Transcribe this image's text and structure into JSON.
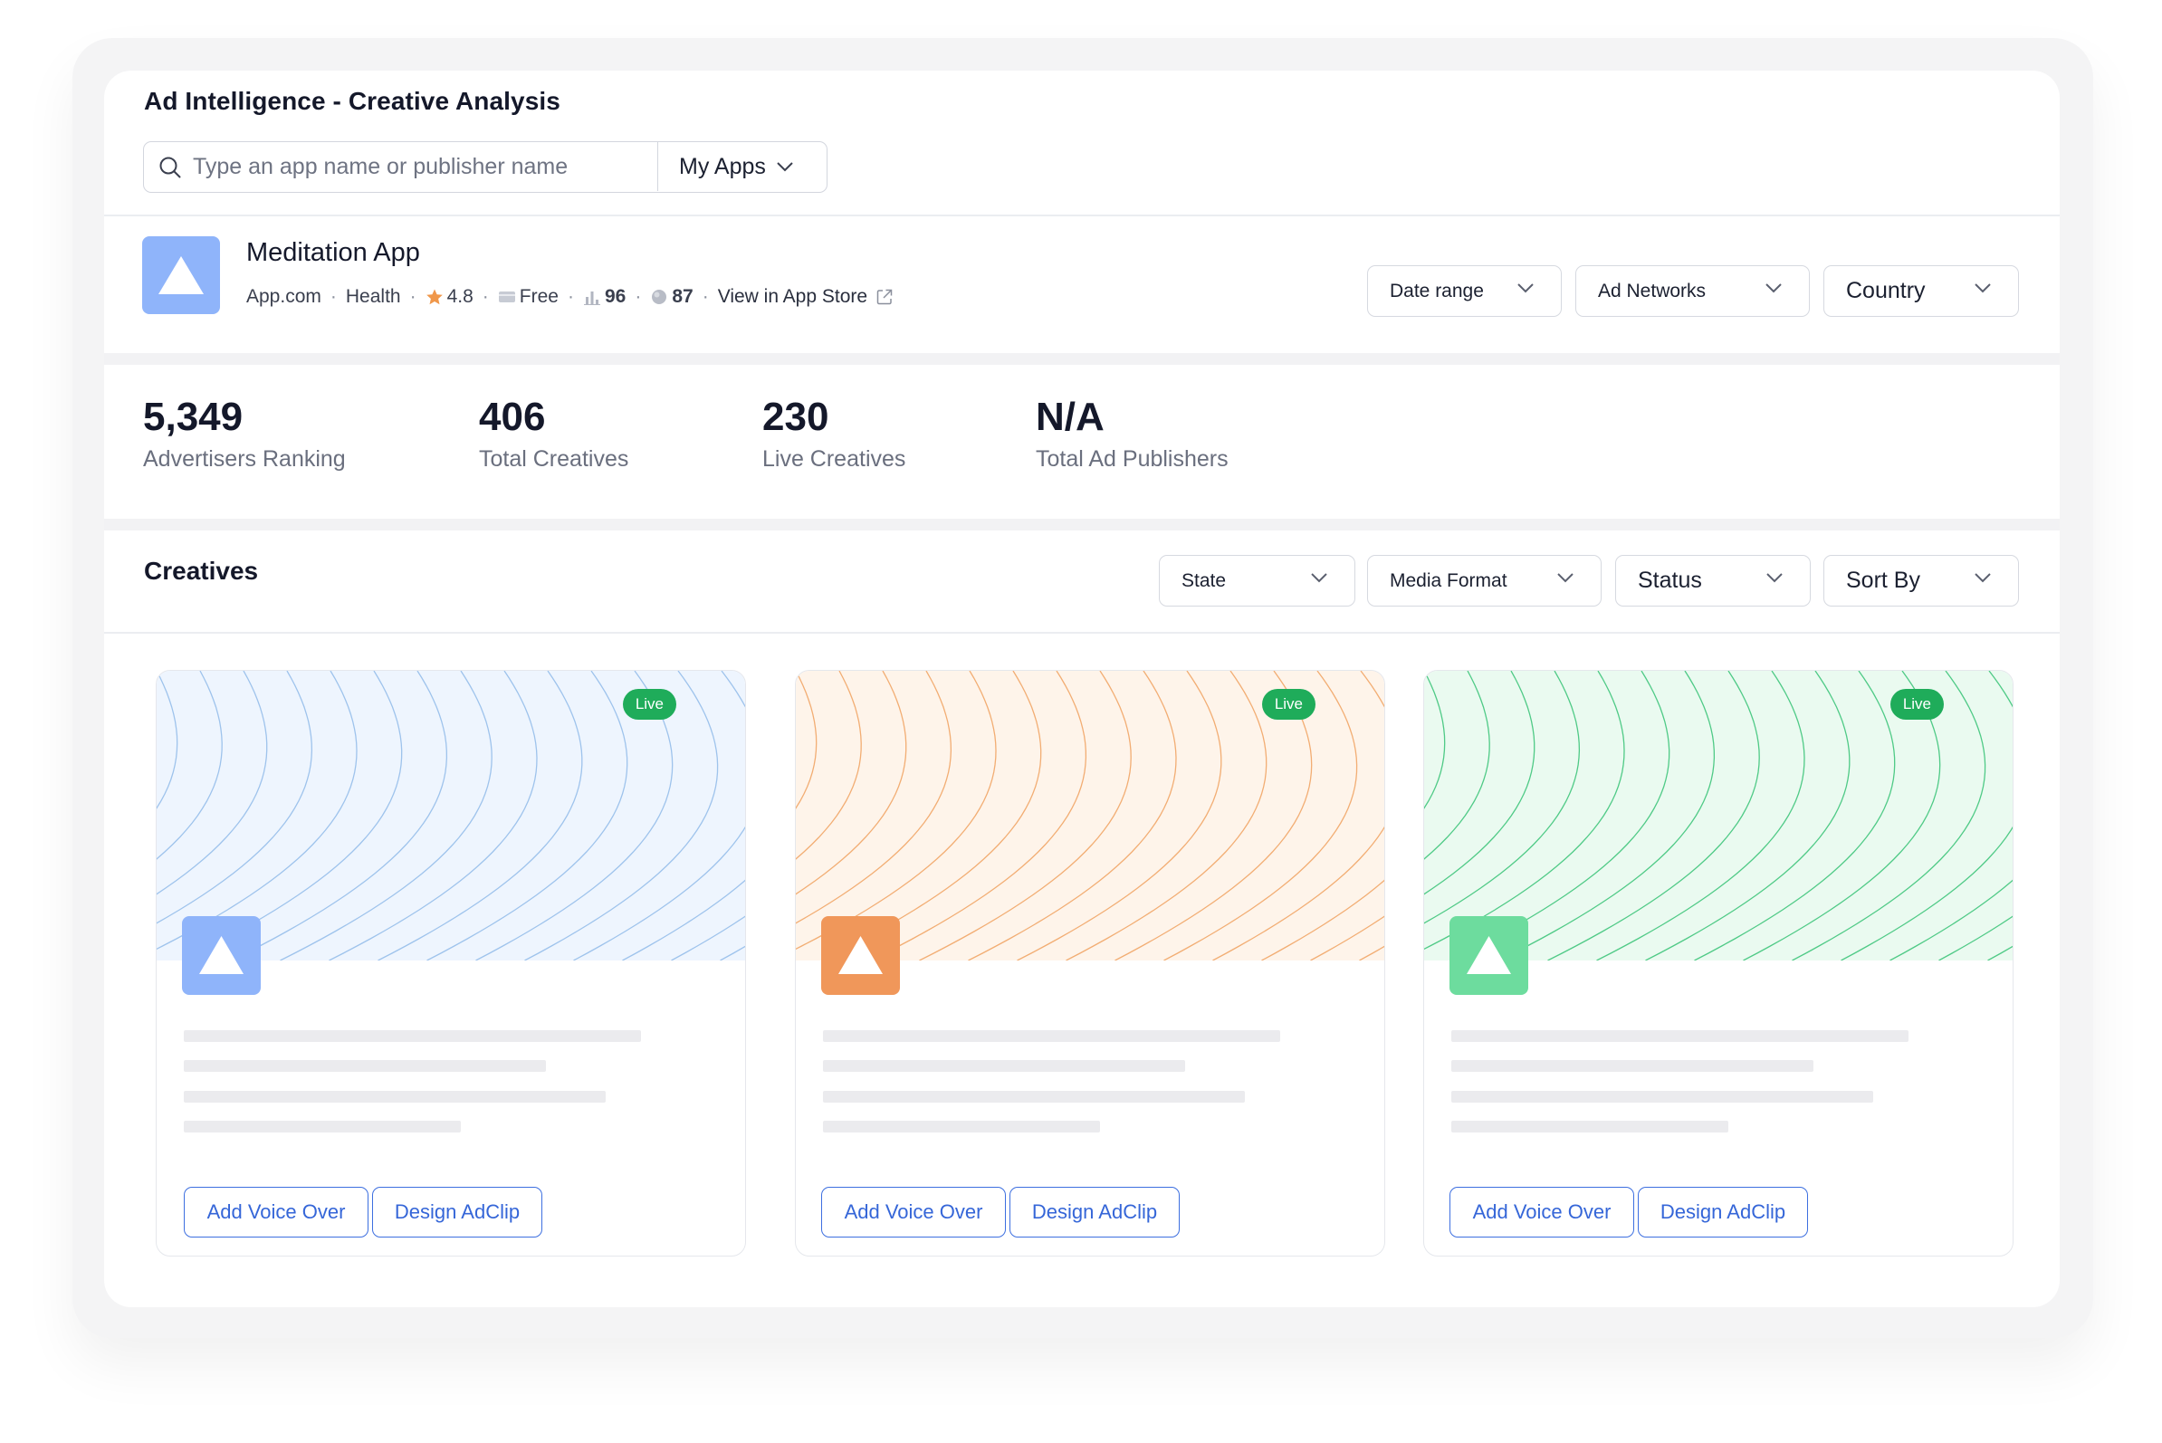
{
  "page_title": "Ad Intelligence - Creative Analysis",
  "search": {
    "placeholder": "Type an app name or publisher name",
    "value": ""
  },
  "scope_dropdown": {
    "label": "My Apps"
  },
  "app": {
    "name": "Meditation App",
    "publisher": "App.com",
    "category": "Health",
    "rating": "4.8",
    "price": "Free",
    "rank_metric": "96",
    "score_metric": "87",
    "store_link": "View in App Store"
  },
  "filters": {
    "date_range": "Date range",
    "ad_networks": "Ad Networks",
    "country": "Country"
  },
  "stats": [
    {
      "value": "5,349",
      "label": "Advertisers Ranking"
    },
    {
      "value": "406",
      "label": "Total Creatives"
    },
    {
      "value": "230",
      "label": "Live Creatives"
    },
    {
      "value": "N/A",
      "label": "Total Ad Publishers"
    }
  ],
  "creatives": {
    "title": "Creatives",
    "filters": {
      "state": "State",
      "media_format": "Media Format",
      "status": "Status",
      "sort_by": "Sort By"
    },
    "cards": [
      {
        "badge": "Live",
        "accent": "#8fb4fa",
        "bg": "#eef5fe",
        "line": "#9ec3ec",
        "voice_over": "Add Voice Over",
        "design": "Design AdClip"
      },
      {
        "badge": "Live",
        "accent": "#f0975a",
        "bg": "#fef4ea",
        "line": "#f2ad73",
        "voice_over": "Add Voice Over",
        "design": "Design AdClip"
      },
      {
        "badge": "Live",
        "accent": "#6ddc9e",
        "bg": "#eafaf0",
        "line": "#4fca86",
        "voice_over": "Add Voice Over",
        "design": "Design AdClip"
      }
    ]
  }
}
